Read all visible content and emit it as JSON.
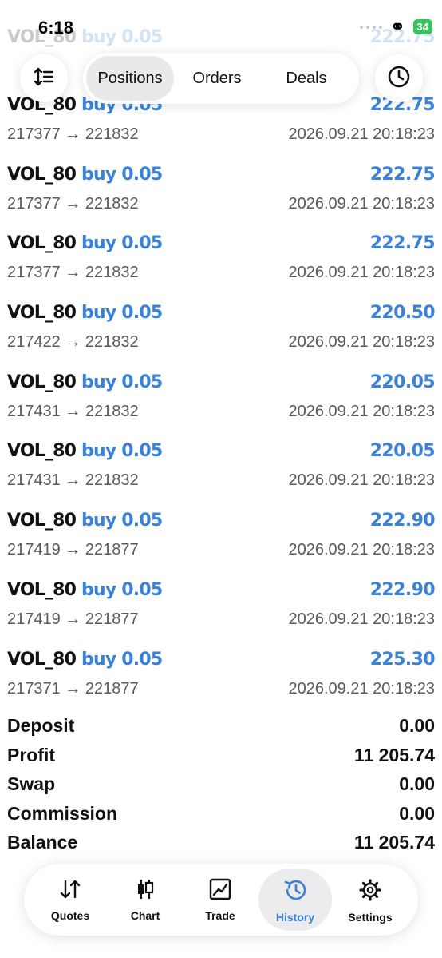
{
  "status_bar": {
    "time": "6:18",
    "battery": "34"
  },
  "faded_header": {
    "symbol": "VOL_80",
    "side": "buy",
    "volume": "0.05",
    "price": "222.75"
  },
  "toolbar": {
    "sort_icon": "sort-icon",
    "tabs": [
      "Positions",
      "Orders",
      "Deals"
    ],
    "active_tab": "Positions",
    "clock_icon": "clock-icon"
  },
  "deals": [
    {
      "symbol": "VOL_80",
      "side": "buy",
      "volume": "0.05",
      "price": "222.75",
      "route": "217377 → 221832",
      "time": "2026.09.21 20:18:23"
    },
    {
      "symbol": "VOL_80",
      "side": "buy",
      "volume": "0.05",
      "price": "222.75",
      "route": "217377 → 221832",
      "time": "2026.09.21 20:18:23"
    },
    {
      "symbol": "VOL_80",
      "side": "buy",
      "volume": "0.05",
      "price": "222.75",
      "route": "217377 → 221832",
      "time": "2026.09.21 20:18:23"
    },
    {
      "symbol": "VOL_80",
      "side": "buy",
      "volume": "0.05",
      "price": "220.50",
      "route": "217422 → 221832",
      "time": "2026.09.21 20:18:23"
    },
    {
      "symbol": "VOL_80",
      "side": "buy",
      "volume": "0.05",
      "price": "220.05",
      "route": "217431 → 221832",
      "time": "2026.09.21 20:18:23"
    },
    {
      "symbol": "VOL_80",
      "side": "buy",
      "volume": "0.05",
      "price": "220.05",
      "route": "217431 → 221832",
      "time": "2026.09.21 20:18:23"
    },
    {
      "symbol": "VOL_80",
      "side": "buy",
      "volume": "0.05",
      "price": "222.90",
      "route": "217419 → 221877",
      "time": "2026.09.21 20:18:23"
    },
    {
      "symbol": "VOL_80",
      "side": "buy",
      "volume": "0.05",
      "price": "222.90",
      "route": "217419 → 221877",
      "time": "2026.09.21 20:18:23"
    },
    {
      "symbol": "VOL_80",
      "side": "buy",
      "volume": "0.05",
      "price": "225.30",
      "route": "217371 → 221877",
      "time": "2026.09.21 20:18:23"
    }
  ],
  "summary": [
    {
      "label": "Deposit",
      "value": "0.00"
    },
    {
      "label": "Profit",
      "value": "11 205.74"
    },
    {
      "label": "Swap",
      "value": "0.00"
    },
    {
      "label": "Commission",
      "value": "0.00"
    },
    {
      "label": "Balance",
      "value": "11 205.74"
    }
  ],
  "bottom_nav": {
    "items": [
      {
        "label": "Quotes",
        "icon": "quotes-icon"
      },
      {
        "label": "Chart",
        "icon": "candlestick-icon"
      },
      {
        "label": "Trade",
        "icon": "trade-icon"
      },
      {
        "label": "History",
        "icon": "history-icon"
      },
      {
        "label": "Settings",
        "icon": "settings-gear-icon"
      }
    ],
    "active": "History"
  },
  "colors": {
    "accent": "#3a82d8",
    "text": "#111111",
    "secondary": "#5a5a5e",
    "battery": "#39c25b",
    "active_bg": "#ececee"
  }
}
